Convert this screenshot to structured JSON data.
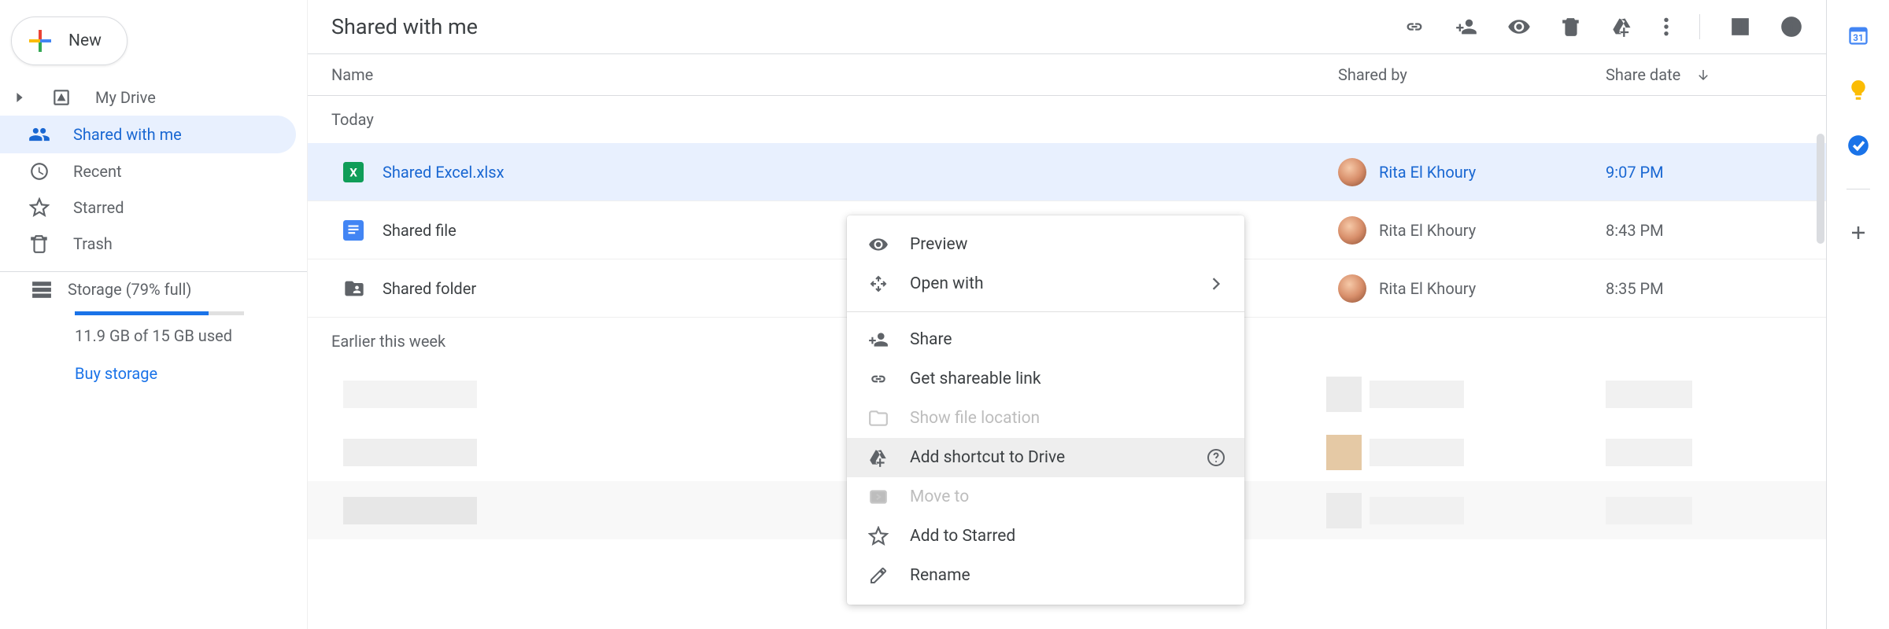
{
  "sidebar": {
    "new_label": "New",
    "items": [
      {
        "label": "My Drive"
      },
      {
        "label": "Shared with me"
      },
      {
        "label": "Recent"
      },
      {
        "label": "Starred"
      },
      {
        "label": "Trash"
      }
    ],
    "storage": {
      "label": "Storage (79% full)",
      "detail": "11.9 GB of 15 GB used",
      "buy": "Buy storage"
    }
  },
  "page": {
    "title": "Shared with me"
  },
  "columns": {
    "name": "Name",
    "shared_by": "Shared by",
    "share_date": "Share date"
  },
  "sections": {
    "today": "Today",
    "earlier_week": "Earlier this week"
  },
  "files": [
    {
      "name": "Shared Excel.xlsx",
      "shared_by": "Rita El Khoury",
      "date": "9:07 PM"
    },
    {
      "name": "Shared file",
      "shared_by": "Rita El Khoury",
      "date": "8:43 PM"
    },
    {
      "name": "Shared folder",
      "shared_by": "Rita El Khoury",
      "date": "8:35 PM"
    }
  ],
  "menu": {
    "preview": "Preview",
    "open_with": "Open with",
    "share": "Share",
    "get_link": "Get shareable link",
    "show_loc": "Show file location",
    "add_shortcut": "Add shortcut to Drive",
    "move_to": "Move to",
    "add_starred": "Add to Starred",
    "rename": "Rename"
  }
}
